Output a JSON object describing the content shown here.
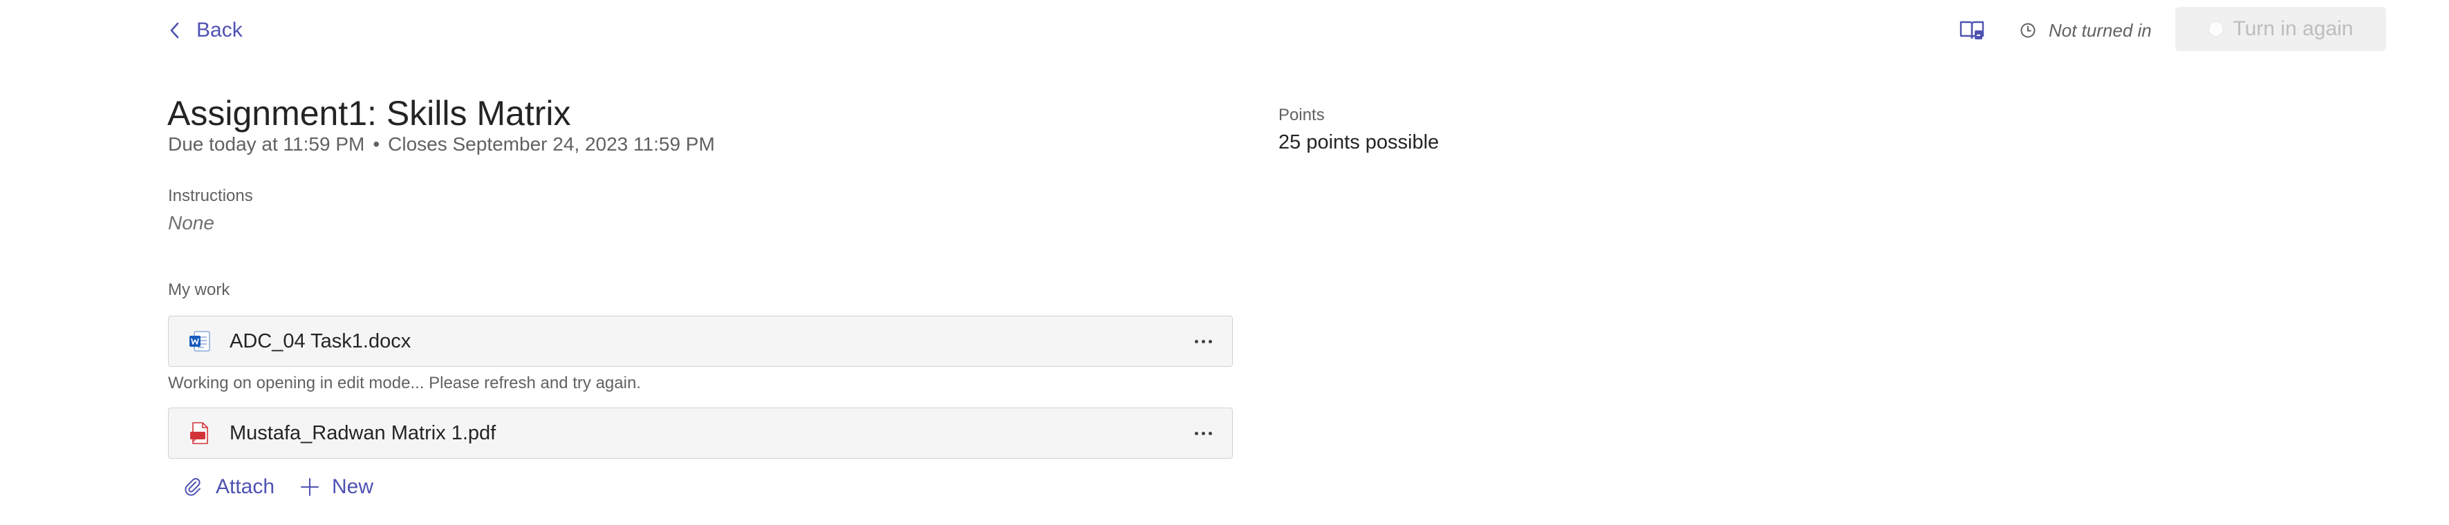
{
  "nav": {
    "back_label": "Back"
  },
  "header": {
    "reader_icon": "immersive-reader-icon",
    "status_icon": "clock-icon",
    "status_text": "Not turned in",
    "turn_in_label": "Turn in again"
  },
  "assignment": {
    "title": "Assignment1: Skills Matrix",
    "due": "Due today at 11:59 PM",
    "separator": "•",
    "closes": "Closes September 24, 2023 11:59 PM",
    "instructions_label": "Instructions",
    "instructions_value": "None"
  },
  "points": {
    "label": "Points",
    "value": "25 points possible"
  },
  "my_work": {
    "label": "My work",
    "files": [
      {
        "name": "ADC_04 Task1.docx",
        "type": "word",
        "icon": "word-file-icon"
      },
      {
        "name": "Mustafa_Radwan Matrix 1.pdf",
        "type": "pdf",
        "icon": "pdf-file-icon"
      }
    ],
    "file_note": "Working on opening in edit mode... Please refresh and try again."
  },
  "actions": {
    "attach_label": "Attach",
    "new_label": "New"
  },
  "colors": {
    "accent": "#4f52b2",
    "text": "#242424",
    "muted": "#616161",
    "card_bg": "#f5f5f5",
    "word_blue": "#185abd",
    "pdf_red": "#d13438"
  }
}
